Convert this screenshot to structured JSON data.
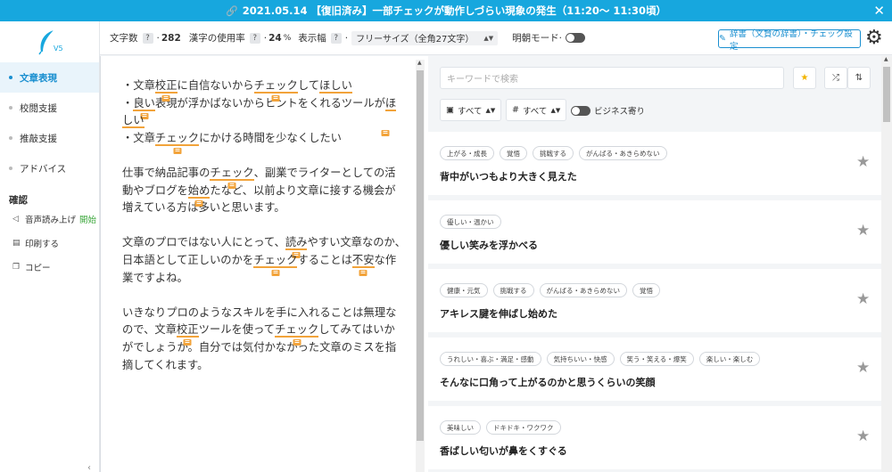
{
  "banner": {
    "text": "2021.05.14 【復旧済み】一部チェックが動作しづらい現象の発生（11:20〜 11:30頃）",
    "close": "✕"
  },
  "logo": {
    "version": "V5"
  },
  "nav": [
    {
      "label": "文章表現"
    },
    {
      "label": "校閲支援"
    },
    {
      "label": "推敲支援"
    },
    {
      "label": "アドバイス"
    }
  ],
  "confirm": {
    "title": "確認",
    "read_aloud": "音声読み上げ",
    "read_aloud_action": "開始",
    "print": "印刷する",
    "copy": "コピー"
  },
  "toolbar": {
    "char_count_label": "文字数",
    "char_count": "282",
    "kanji_rate_label": "漢字の使用率",
    "kanji_rate": "24",
    "kanji_rate_unit": "%",
    "display_width_label": "表示幅",
    "display_width_value": "フリーサイズ（全角27文字）",
    "mincho_label": "明朝モード",
    "dict_button": "辞書（文賢の辞書）・チェック設定",
    "help_mark": "?"
  },
  "editor": {
    "bullets": [
      "・文章校正に自信ないからチェックしてほしい",
      "・良い表現が浮かばないからヒントをくれるツールがほしい",
      "・文章チェックにかける時間を少なくしたい"
    ],
    "para1": "仕事で納品記事のチェック、副業でライターとしての活動やブログを始めたなど、以前より文章に接する機会が増えている方は多いと思います。",
    "para2": "文章のプロではない人にとって、読みやすい文章なのか、日本語として正しいのかをチェックすることは不安な作業ですよね。",
    "para3": "いきなりプロのようなスキルを手に入れることは無理なので、文章校正ツールを使ってチェックしてみてはいかがでしょうか。自分では気付かなかった文章のミスを指摘してくれます。"
  },
  "search": {
    "placeholder": "キーワードで検索"
  },
  "filters": {
    "category": "すべて",
    "tag": "すべて",
    "business": "ビジネス寄り"
  },
  "cards": [
    {
      "tags": [
        "上がる・成長",
        "覚悟",
        "挑戦する",
        "がんばる・あきらめない"
      ],
      "phrase": "背中がいつもより大きく見えた"
    },
    {
      "tags": [
        "優しい・温かい"
      ],
      "phrase": "優しい笑みを浮かべる"
    },
    {
      "tags": [
        "健康・元気",
        "挑戦する",
        "がんばる・あきらめない",
        "覚悟"
      ],
      "phrase": "アキレス腱を伸ばし始めた"
    },
    {
      "tags": [
        "うれしい・喜ぶ・満足・感動",
        "気持ちいい・快感",
        "笑う・笑える・爆笑",
        "楽しい・楽しむ"
      ],
      "phrase": "そんなに口角って上がるのかと思うくらいの笑顔"
    },
    {
      "tags": [
        "美味しい",
        "ドキドキ・ワクワク"
      ],
      "phrase": "香ばしい匂いが鼻をくすぐる"
    }
  ],
  "colors": {
    "accent": "#17a7de",
    "highlight": "#f2a33a",
    "active_nav": "#1a8fd0"
  }
}
